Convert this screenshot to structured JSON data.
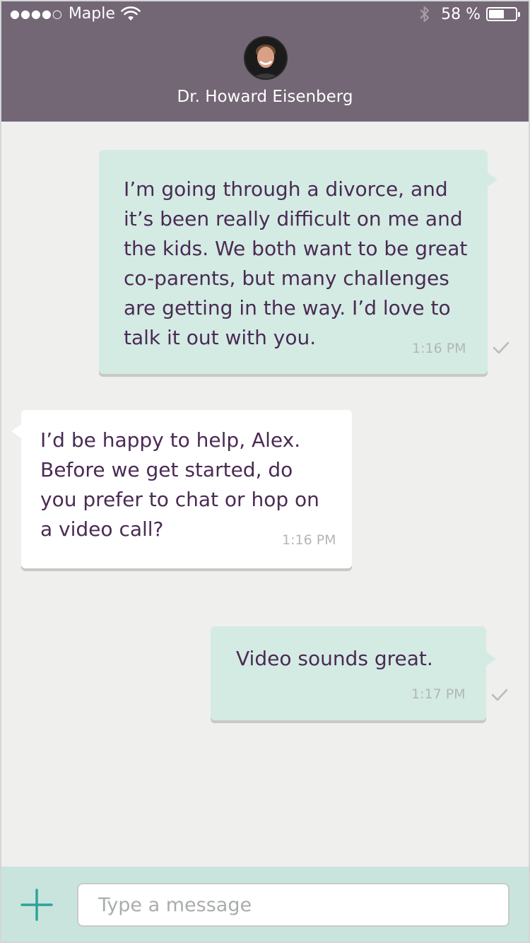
{
  "status_bar": {
    "signal_dots": "●●●●○",
    "carrier": "Maple",
    "battery_percent": "58 %",
    "battery_level": 0.58
  },
  "header": {
    "contact_name": "Dr. Howard Eisenberg"
  },
  "messages": [
    {
      "direction": "outgoing",
      "lines": [
        "I’m going through a divorce, and",
        "it’s been really difficult on me and",
        "the kids. We both want to be great",
        "co-parents, but many challenges",
        "are getting in the way. I’d love to",
        "talk it out with you."
      ],
      "time": "1:16 PM",
      "delivered": true
    },
    {
      "direction": "incoming",
      "lines": [
        "I’d be happy to help, Alex.",
        "Before we get started, do",
        "you prefer to chat or hop on",
        "a video call?"
      ],
      "time": "1:16 PM"
    },
    {
      "direction": "outgoing",
      "lines": [
        "Video sounds great."
      ],
      "time": "1:17 PM",
      "delivered": true
    }
  ],
  "composer": {
    "placeholder": "Type a message"
  },
  "colors": {
    "header_bg": "#736675",
    "outgoing_bubble": "#d4ebe4",
    "incoming_bubble": "#ffffff",
    "message_text": "#4a2b53",
    "accent": "#2aa39a",
    "input_bar_bg": "#c9e4dc"
  }
}
